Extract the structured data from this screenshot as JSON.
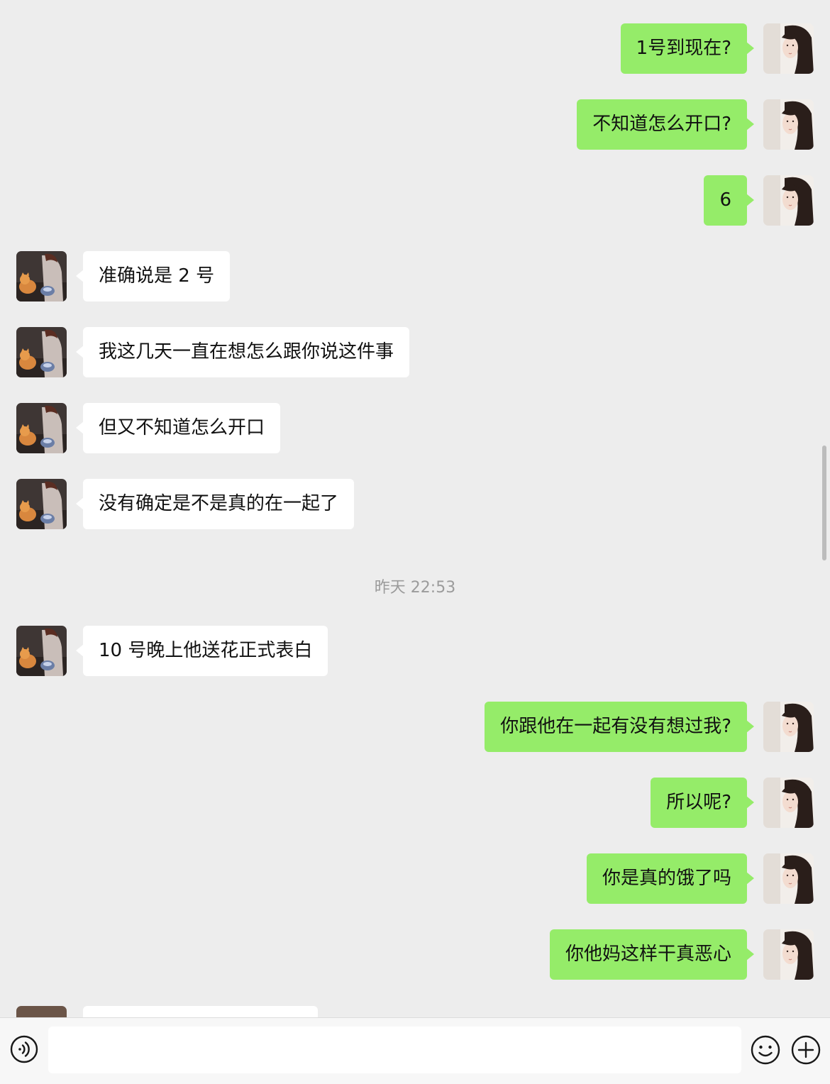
{
  "colors": {
    "background": "#ededed",
    "outgoing_bubble": "#95ec69",
    "incoming_bubble": "#ffffff",
    "timestamp_text": "#9b9b9b"
  },
  "messages": [
    {
      "direction": "out",
      "text": "1号到现在?"
    },
    {
      "direction": "out",
      "text": "不知道怎么开口?"
    },
    {
      "direction": "out",
      "text": "6"
    },
    {
      "direction": "in",
      "text": "准确说是 2 号"
    },
    {
      "direction": "in",
      "text": "我这几天一直在想怎么跟你说这件事"
    },
    {
      "direction": "in",
      "text": "但又不知道怎么开口"
    },
    {
      "direction": "in",
      "text": "没有确定是不是真的在一起了"
    },
    {
      "direction": "in",
      "text": "10 号晚上他送花正式表白"
    },
    {
      "direction": "out",
      "text": "你跟他在一起有没有想过我?"
    },
    {
      "direction": "out",
      "text": "所以呢?"
    },
    {
      "direction": "out",
      "text": "你是真的饿了吗"
    },
    {
      "direction": "out",
      "text": "你他妈这样干真恶心"
    }
  ],
  "timestamp": "昨天 22:53",
  "input_bar": {
    "voice_icon": "voice-icon",
    "input_value": "",
    "emoji_icon": "emoji-icon",
    "more_icon": "plus-icon"
  }
}
